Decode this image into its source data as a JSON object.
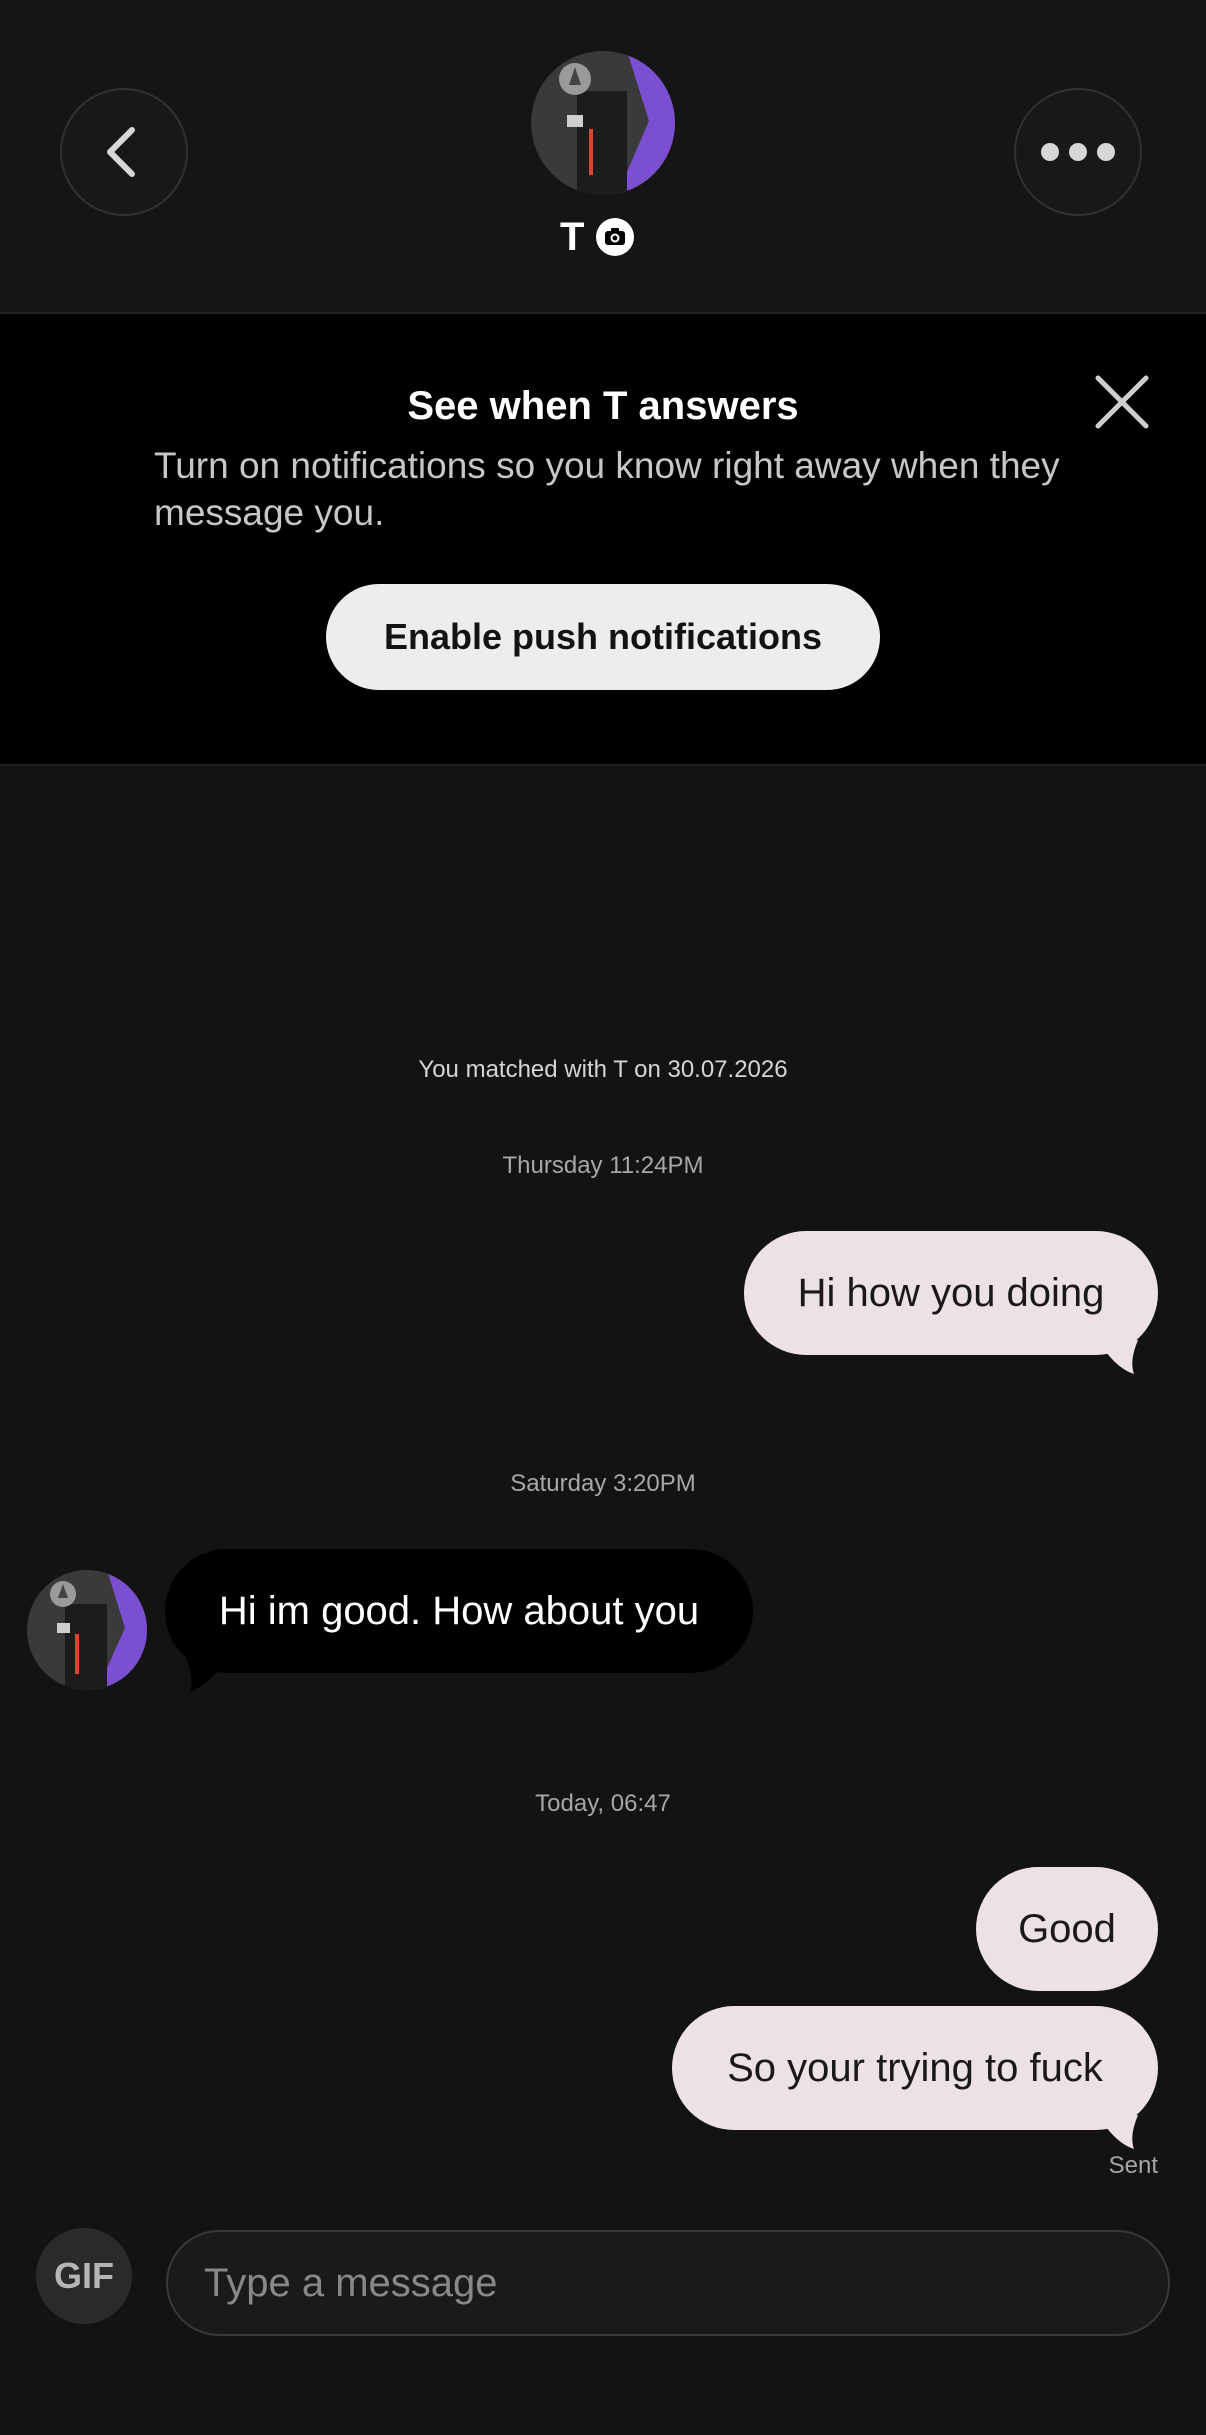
{
  "header": {
    "match_name": "T",
    "back_icon": "chevron-left-icon",
    "more_icon": "more-horizontal-icon",
    "badge_icon": "camera-icon"
  },
  "banner": {
    "title": "See when T answers",
    "body": "Turn on notifications so you know right away when they message you.",
    "button_label": "Enable push notifications",
    "close_icon": "close-icon"
  },
  "chat": {
    "matched_text": "You matched with T on 30.07.2026",
    "messages": [
      {
        "timestamp": "Thursday 11:24PM",
        "text": "Hi how you doing",
        "direction": "outgoing"
      },
      {
        "timestamp": "Saturday 3:20PM",
        "text": "Hi im good. How about you",
        "direction": "incoming"
      },
      {
        "timestamp": "Today, 06:47",
        "text": "Good",
        "direction": "outgoing"
      },
      {
        "timestamp": "",
        "text": "So your trying to fuck",
        "direction": "outgoing"
      }
    ],
    "status": "Sent"
  },
  "composer": {
    "gif_label": "GIF",
    "placeholder": "Type a message"
  },
  "colors": {
    "background": "#141313",
    "outgoing_bubble": "#ece2e3",
    "incoming_bubble": "#000000",
    "banner_background": "#000000",
    "button_background": "#efedec",
    "avatar_accent": "#7b4fd1"
  }
}
